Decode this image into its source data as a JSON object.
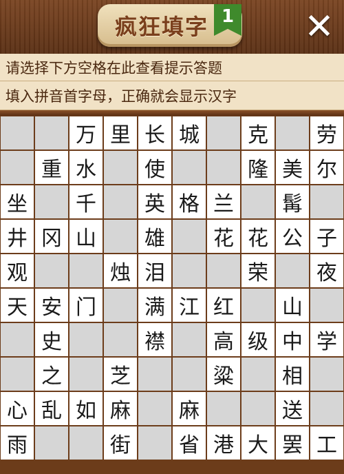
{
  "header": {
    "title": "疯狂填字",
    "level": "1",
    "close_label": "✕"
  },
  "hints": {
    "line1": "请选择下方空格在此查看提示答题",
    "line2": "填入拼音首字母，正确就会显示汉字"
  },
  "grid": [
    [
      null,
      null,
      "万",
      "里",
      "长",
      "城",
      null,
      "克",
      null,
      "劳"
    ],
    [
      null,
      "重",
      "水",
      null,
      "使",
      null,
      null,
      "隆",
      "美",
      "尔"
    ],
    [
      "坐",
      null,
      "千",
      null,
      "英",
      "格",
      "兰",
      null,
      "髯",
      null
    ],
    [
      "井",
      "冈",
      "山",
      null,
      "雄",
      null,
      "花",
      "花",
      "公",
      "子"
    ],
    [
      "观",
      null,
      null,
      "烛",
      "泪",
      null,
      null,
      "荣",
      null,
      "夜"
    ],
    [
      "天",
      "安",
      "门",
      null,
      "满",
      "江",
      "红",
      null,
      "山",
      null
    ],
    [
      null,
      "史",
      null,
      null,
      "襟",
      null,
      "高",
      "级",
      "中",
      "学"
    ],
    [
      null,
      "之",
      null,
      "芝",
      null,
      null,
      "粱",
      null,
      "相",
      null
    ],
    [
      "心",
      "乱",
      "如",
      "麻",
      null,
      "麻",
      null,
      null,
      "送",
      null
    ],
    [
      "雨",
      null,
      null,
      "街",
      null,
      "省",
      "港",
      "大",
      "罢",
      "工"
    ]
  ],
  "colors": {
    "header_wood": "#6a3a1c",
    "hint_bg": "#f1e2c6",
    "blank_cell": "#d6d6d6",
    "filled_cell": "#ffffff",
    "badge_green": "#3f8a2c"
  }
}
